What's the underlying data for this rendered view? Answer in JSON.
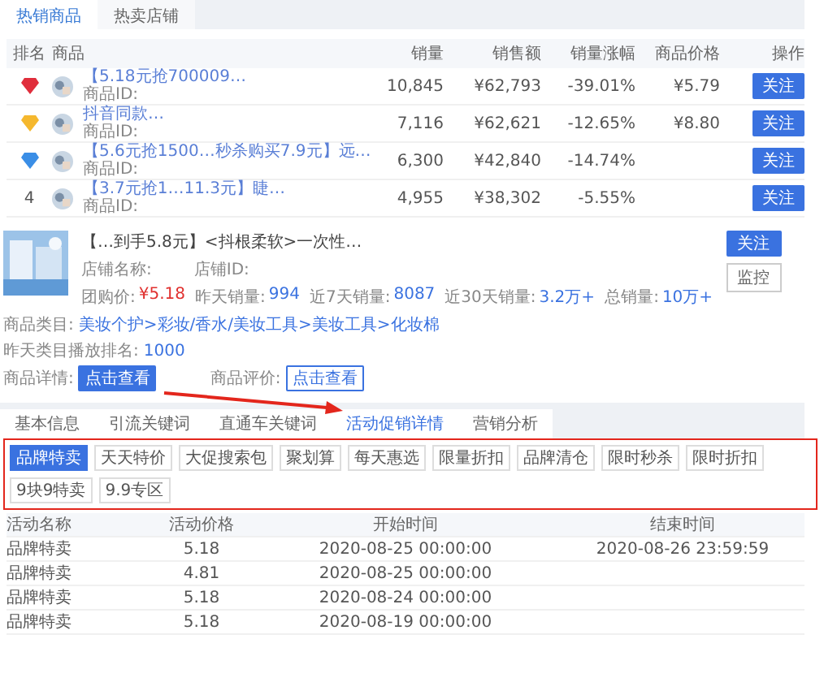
{
  "top_tabs": [
    {
      "label": "热销商品",
      "selected": true
    },
    {
      "label": "热卖店铺",
      "selected": false
    }
  ],
  "ranking": {
    "columns": [
      "排名",
      "商品",
      "销量",
      "销售额",
      "销量涨幅",
      "商品价格",
      "操作"
    ],
    "rows": [
      {
        "kind": "medal",
        "color": "#e02e3c",
        "title": "【5.18元抢700009…",
        "id_label": "商品ID:",
        "sales": "10,845",
        "amount": "¥62,793",
        "growth": "-39.01%",
        "price": "¥5.79",
        "action": "关注"
      },
      {
        "kind": "medal",
        "color": "#f5b82e",
        "title": "抖音同款…",
        "id_label": "商品ID:",
        "sales": "7,116",
        "amount": "¥62,621",
        "growth": "-12.65%",
        "price": "¥8.80",
        "action": "关注"
      },
      {
        "kind": "medal",
        "color": "#3a8ee6",
        "title": "【5.6元抢1500…秒杀购买7.9元】远…",
        "id_label": "商品ID:",
        "sales": "6,300",
        "amount": "¥42,840",
        "growth": "-14.74%",
        "action": "关注"
      },
      {
        "kind": "number",
        "rank": "4",
        "title": "【3.7元抢1…11.3元】睫…",
        "id_label": "商品ID:",
        "sales": "4,955",
        "amount": "¥38,302",
        "growth": "-5.55%",
        "action": "关注"
      }
    ]
  },
  "product": {
    "title": "【…到手5.8元】<抖根柔软>一次性…",
    "shop_label": "店铺名称:",
    "shop_id_label": "店铺ID:",
    "stats": [
      {
        "label": "团购价:",
        "value": "¥5.18",
        "kind": "price"
      },
      {
        "label": "昨天销量:",
        "value": "994",
        "kind": "count"
      },
      {
        "label": "近7天销量:",
        "value": "8087",
        "kind": "count"
      },
      {
        "label": "近30天销量:",
        "value": "3.2万+",
        "kind": "count"
      },
      {
        "label": "总销量:",
        "value": "10万+",
        "kind": "count"
      }
    ],
    "buttons": [
      {
        "label": "关注",
        "kind": "primary"
      },
      {
        "label": "监控",
        "kind": "plain"
      }
    ],
    "category_label": "商品类目:",
    "category": "美妆个护>彩妆/香水/美妆工具>美妆工具>化妆棉",
    "rank_label": "昨天类目播放排名:",
    "rank_value": "1000",
    "links": [
      {
        "label": "商品详情:",
        "button": "点击查看",
        "kind": "filled"
      },
      {
        "label": "商品评价:",
        "button": "点击查看",
        "kind": "outline"
      }
    ]
  },
  "detail_tabs": [
    {
      "label": "基本信息",
      "selected": false
    },
    {
      "label": "引流关键词",
      "selected": false
    },
    {
      "label": "直通车关键词",
      "selected": false
    },
    {
      "label": "活动促销详情",
      "selected": true
    },
    {
      "label": "营销分析",
      "selected": false
    }
  ],
  "promo_chips": [
    {
      "label": "品牌特卖",
      "selected": true
    },
    {
      "label": "天天特价",
      "selected": false
    },
    {
      "label": "大促搜索包",
      "selected": false
    },
    {
      "label": "聚划算",
      "selected": false
    },
    {
      "label": "每天惠选",
      "selected": false
    },
    {
      "label": "限量折扣",
      "selected": false
    },
    {
      "label": "品牌清仓",
      "selected": false
    },
    {
      "label": "限时秒杀",
      "selected": false
    },
    {
      "label": "限时折扣",
      "selected": false
    },
    {
      "label": "9块9特卖",
      "selected": false
    },
    {
      "label": "9.9专区",
      "selected": false
    }
  ],
  "promo_table": {
    "columns": [
      "活动名称",
      "活动价格",
      "开始时间",
      "结束时间"
    ],
    "rows": [
      [
        "品牌特卖",
        "5.18",
        "2020-08-25 00:00:00",
        "2020-08-26 23:59:59"
      ],
      [
        "品牌特卖",
        "4.81",
        "2020-08-25 00:00:00"
      ],
      [
        "品牌特卖",
        "5.18",
        "2020-08-24 00:00:00"
      ],
      [
        "品牌特卖",
        "5.18",
        "2020-08-19 00:00:00"
      ]
    ]
  }
}
